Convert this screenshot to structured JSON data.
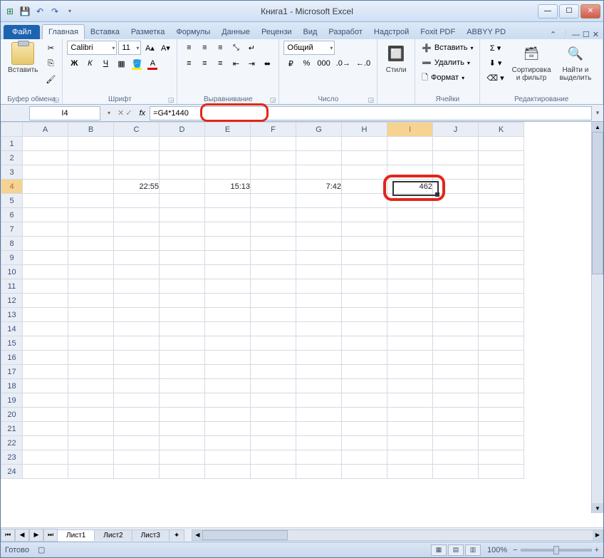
{
  "title": "Книга1 - Microsoft Excel",
  "tabs": {
    "file": "Файл",
    "items": [
      "Главная",
      "Вставка",
      "Разметка",
      "Формулы",
      "Данные",
      "Рецензи",
      "Вид",
      "Разработ",
      "Надстрой",
      "Foxit PDF",
      "ABBYY PD"
    ],
    "active": 0
  },
  "ribbon": {
    "clipboard": {
      "title": "Буфер обмена",
      "paste": "Вставить"
    },
    "font": {
      "title": "Шрифт",
      "name": "Calibri",
      "size": "11",
      "bold": "Ж",
      "italic": "К",
      "underline": "Ч"
    },
    "align": {
      "title": "Выравнивание"
    },
    "number": {
      "title": "Число",
      "format": "Общий"
    },
    "styles": {
      "title": "",
      "label": "Стили"
    },
    "cells": {
      "title": "Ячейки",
      "insert": "Вставить",
      "delete": "Удалить",
      "format": "Формат"
    },
    "editing": {
      "title": "Редактирование",
      "sort": "Сортировка\nи фильтр",
      "find": "Найти и\nвыделить"
    }
  },
  "namebox": "I4",
  "formula": "=G4*1440",
  "columns": [
    "A",
    "B",
    "C",
    "D",
    "E",
    "F",
    "G",
    "H",
    "I",
    "J",
    "K"
  ],
  "rows": 24,
  "cells": {
    "C4": "22:55",
    "E4": "15:13",
    "G4": "7:42",
    "I4": "462"
  },
  "selected": {
    "col": "I",
    "row": 4
  },
  "sheets": [
    "Лист1",
    "Лист2",
    "Лист3"
  ],
  "status": {
    "ready": "Готово",
    "zoom": "100%"
  }
}
